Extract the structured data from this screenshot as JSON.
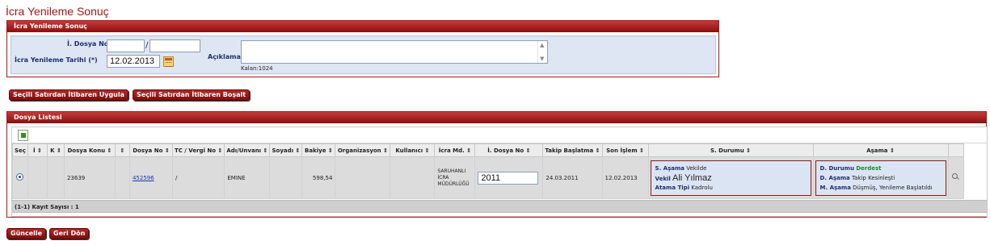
{
  "page": {
    "title": "İcra Yenileme Sonuç"
  },
  "form": {
    "header": "İcra Yenileme Sonuç",
    "dosya_no_label": "İ. Dosya No",
    "dosya_no_part1": "",
    "dosya_no_part2": "",
    "separator": "/",
    "tarih_label": "İcra Yenileme Tarihi (*)",
    "tarih_value": "12.02.2013",
    "aciklama_label": "Açıklama",
    "aciklama_value": "",
    "kalan_label": "Kalan:1024"
  },
  "actions": {
    "apply_label": "Seçili Satırdan İtibaren Uygula",
    "clear_label": "Seçili Satırdan İtibaren Boşalt"
  },
  "list": {
    "header": "Dosya Listesi",
    "columns": [
      "Seç",
      "İ",
      "K",
      "Dosya Konu",
      "",
      "Dosya No",
      "TC / Vergi No",
      "Adı/Unvanı",
      "Soyadı",
      "Bakiye",
      "Organizasyon",
      "Kullanıcı",
      "İcra Md.",
      "İ. Dosya No",
      "Takip Başlatma",
      "Son İşlem",
      "S. Durumu",
      "Aşama"
    ],
    "rows": [
      {
        "dosya_konu": "23639",
        "dosya_no": "452596",
        "tc_vergi": "/",
        "adi": "EMINE",
        "soyadi": "",
        "bakiye": "598,54",
        "organizasyon": "",
        "kullanici": "",
        "icra_md": "SARUHANLI İCRA MÜDÜRLÜĞÜ",
        "i_dosya_no": "2011",
        "takip_baslatma": "24.03.2011",
        "son_islem": "12.02.2013",
        "s_durumu": {
          "s_asama_label": "S. Aşama",
          "s_asama_value": "Vekilde",
          "vekil_label": "Vekil",
          "vekil_value": "Ali Yılmaz",
          "atama_tipi_label": "Atama Tipi",
          "atama_tipi_value": "Kadrolu"
        },
        "asama": {
          "d_durumu_label": "D. Durumu",
          "d_durumu_value": "Derdest",
          "d_asama_label": "D. Aşama",
          "d_asama_value": "Takip Kesinleşti",
          "m_asama_label": "M. Aşama",
          "m_asama_value": "Düşmüş, Yenileme Başlatıldı"
        }
      }
    ],
    "record_count": "(1-1) Kayıt Sayısı : 1",
    "sort_glyph": "⇕"
  },
  "bottom": {
    "update_label": "Güncelle",
    "back_label": "Geri Dön"
  },
  "colors": {
    "brand_red": "#9c1a1a",
    "form_bg": "#dde6f2",
    "label_blue": "#1f2f6e",
    "status_green": "#1f8a2a"
  },
  "icons": [
    "calendar-icon",
    "excel-export-icon",
    "radio-selected-icon",
    "magnify-icon",
    "sort-icon"
  ]
}
